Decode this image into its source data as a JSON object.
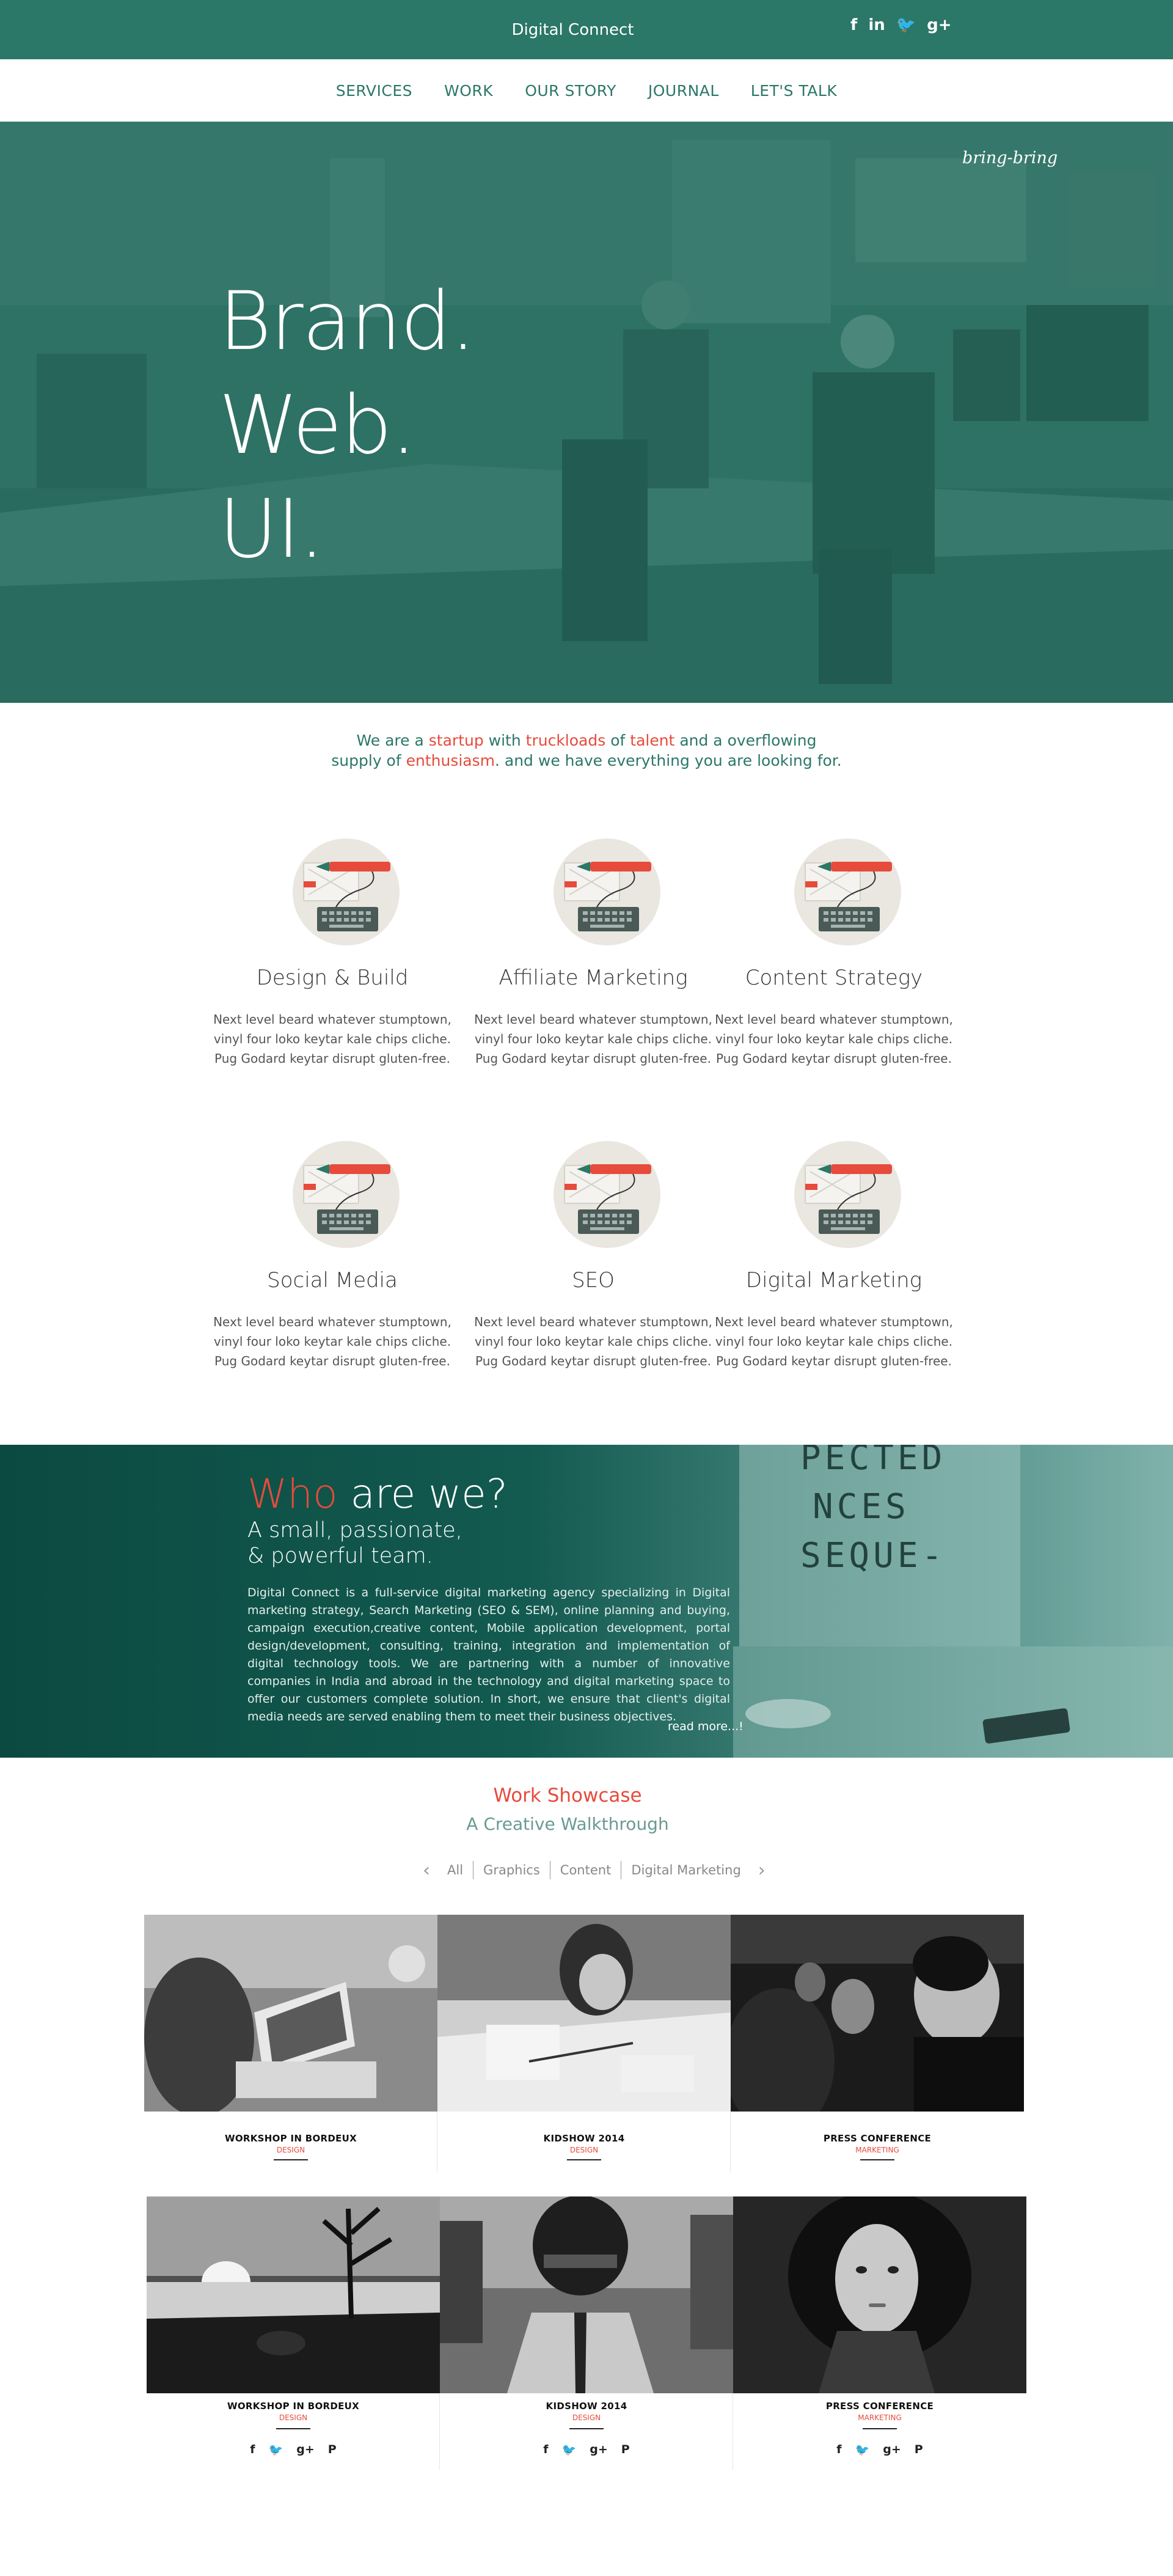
{
  "header": {
    "title": "Digital Connect",
    "social": [
      "f",
      "in",
      "🐦",
      "g+"
    ]
  },
  "nav": [
    "SERVICES",
    "WORK",
    "OUR STORY",
    "JOURNAL",
    "LET'S TALK"
  ],
  "hero": {
    "lines": [
      "Brand.",
      "Web.",
      "UI."
    ],
    "tag": "bring-bring"
  },
  "intro": {
    "line1": {
      "a": "We are a ",
      "b": "startup",
      "c": " with ",
      "d": "truckloads",
      "e": " of ",
      "f": "talent",
      "g": " and a overflowing"
    },
    "line2": {
      "a": "supply of ",
      "b": "enthusiasm",
      "c": ". and we have everything you are looking for."
    }
  },
  "services": [
    {
      "title": "Design & Build",
      "l1": "Next level beard whatever stumptown,",
      "l2": "vinyl four loko keytar kale chips cliche.",
      "l3": "Pug Godard keytar disrupt gluten-free."
    },
    {
      "title": "Affiliate Marketing",
      "l1": "Next level beard whatever stumptown,",
      "l2": "vinyl four loko keytar kale chips cliche.",
      "l3": "Pug Godard keytar disrupt gluten-free."
    },
    {
      "title": "Content Strategy",
      "l1": "Next level beard whatever stumptown,",
      "l2": "vinyl four loko keytar kale chips cliche.",
      "l3": "Pug Godard keytar disrupt gluten-free."
    },
    {
      "title": "Social Media",
      "l1": "Next level beard whatever stumptown,",
      "l2": "vinyl four loko keytar kale chips cliche.",
      "l3": "Pug Godard keytar disrupt gluten-free."
    },
    {
      "title": "SEO",
      "l1": "Next level beard whatever stumptown,",
      "l2": "vinyl four loko keytar kale chips cliche.",
      "l3": "Pug Godard keytar disrupt gluten-free."
    },
    {
      "title": "Digital Marketing",
      "l1": "Next level beard whatever stumptown,",
      "l2": "vinyl four loko keytar kale chips cliche.",
      "l3": "Pug Godard keytar disrupt gluten-free."
    }
  ],
  "about": {
    "title_red": "Who",
    "title_rest": " are we?",
    "sub1": "A small, passionate,",
    "sub2": "& powerful team.",
    "body": "Digital Connect is a full-service digital marketing agency specializing in Digital marketing strategy, Search Marketing (SEO & SEM), online planning and buying, campaign execution,creative content, Mobile application development, portal design/development, consulting, training, integration and implementation of digital technology tools. We are partnering with a number of innovative companies in India and abroad in the technology and digital marketing space to offer our customers complete solution. In short, we ensure that client's digital media needs are served enabling them to meet their business objectives.",
    "read_more": "read more...!",
    "screen_text": [
      "PECTED",
      "NCES",
      "SEQUE-"
    ]
  },
  "work": {
    "title": "Work Showcase",
    "subtitle": "A Creative Walkthrough",
    "filters": [
      "All",
      "Graphics",
      "Content",
      "Digital Marketing"
    ],
    "cards": [
      {
        "title": "WORKSHOP IN BORDEUX",
        "cat": "DESIGN",
        "photo": "kids-laptops-photo"
      },
      {
        "title": "KIDSHOW 2014",
        "cat": "DESIGN",
        "photo": "girl-drawing-photo"
      },
      {
        "title": "PRESS CONFERENCE",
        "cat": "MARKETING",
        "photo": "audience-photo"
      },
      {
        "title": "WORKSHOP IN BORDEUX",
        "cat": "DESIGN",
        "photo": "lake-sunset-photo"
      },
      {
        "title": "KIDSHOW 2014",
        "cat": "DESIGN",
        "photo": "helmet-man-photo"
      },
      {
        "title": "PRESS CONFERENCE",
        "cat": "MARKETING",
        "photo": "woman-portrait-photo"
      }
    ],
    "share": [
      "f",
      "🐦",
      "g+",
      "P"
    ]
  },
  "colors": {
    "teal": "#2b7768",
    "accent_red": "#e64b3c",
    "dark_teal": "#0d4d44"
  }
}
